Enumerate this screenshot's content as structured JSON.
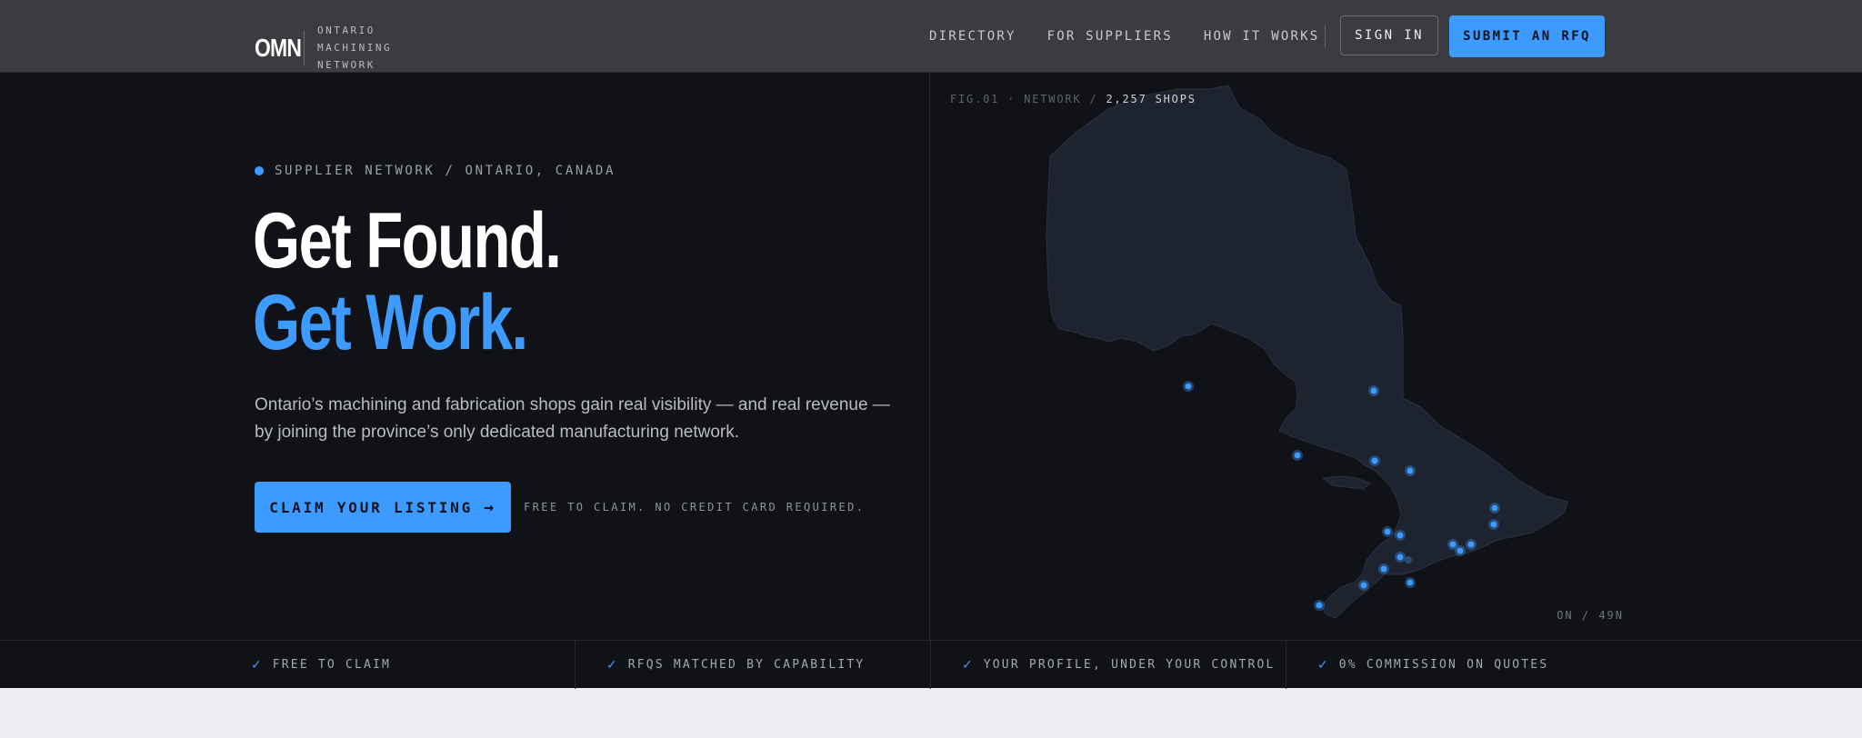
{
  "brand": {
    "mark": "OMN",
    "name_lines": [
      "ONTARIO",
      "MACHINING",
      "NETWORK"
    ]
  },
  "nav": {
    "links": [
      "DIRECTORY",
      "FOR SUPPLIERS",
      "HOW IT WORKS"
    ],
    "sign_in": "SIGN IN",
    "submit_rfq": "SUBMIT AN RFQ"
  },
  "hero": {
    "eyebrow": "SUPPLIER NETWORK / ONTARIO, CANADA",
    "headline_line1": "Get Found.",
    "headline_line2": "Get Work.",
    "lede": "Ontario’s machining and fabrication shops gain real visibility — and real revenue — by joining the province’s only dedicated manufacturing network.",
    "cta_label": "CLAIM YOUR LISTING",
    "cta_arrow": "→",
    "cta_note": "FREE TO CLAIM. NO CREDIT CARD REQUIRED."
  },
  "map": {
    "figure_prefix": "FIG.01 · NETWORK /",
    "figure_count": "2,257 SHOPS",
    "coord_label": "ON / 49N"
  },
  "features": [
    "FREE TO CLAIM",
    "RFQS MATCHED BY CAPABILITY",
    "YOUR PROFILE, UNDER YOUR CONTROL",
    "0% COMMISSION ON QUOTES"
  ],
  "icons": {
    "check": "check-icon",
    "arrow": "arrow-right-icon",
    "status_dot": "status-dot-icon"
  },
  "colors": {
    "accent": "#3d9bff",
    "nav_bg": "#3b3c3f",
    "hero_bg": "#101217",
    "map_fill": "#1e2330"
  }
}
